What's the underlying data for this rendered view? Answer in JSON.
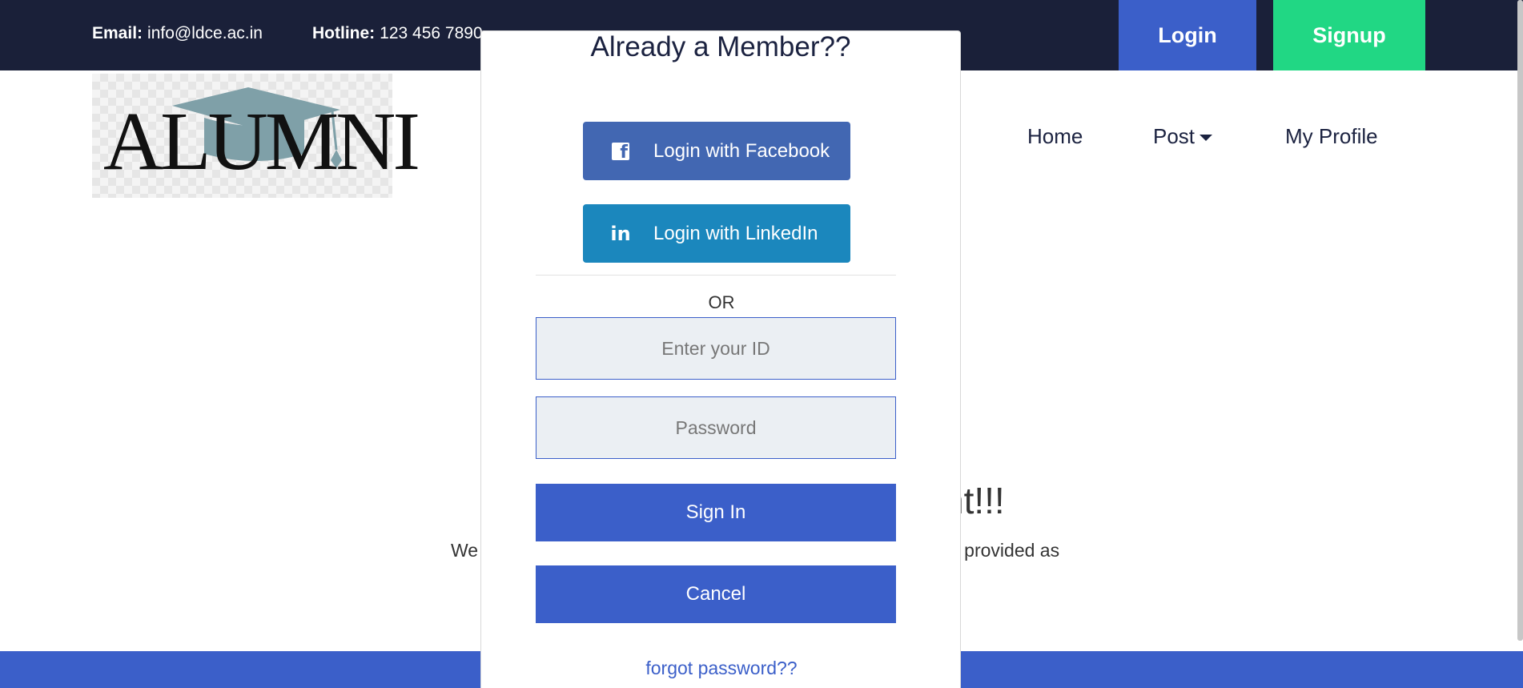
{
  "topbar": {
    "email_label": "Email:",
    "email_value": "info@ldce.ac.in",
    "hotline_label": "Hotline:",
    "hotline_value": "123 456 7890",
    "login_label": "Login",
    "signup_label": "Signup"
  },
  "logo": {
    "text": "ALUMNI"
  },
  "nav": {
    "home": "Home",
    "post": "Post",
    "profile": "My Profile"
  },
  "background": {
    "heading_fragment": "nt!!!",
    "text_left": "We",
    "text_right": "n provided as"
  },
  "modal": {
    "title": "Already a Member??",
    "facebook_label": "Login with Facebook",
    "linkedin_label": "Login with LinkedIn",
    "or_text": "OR",
    "id_placeholder": "Enter your ID",
    "password_placeholder": "Password",
    "signin_label": "Sign In",
    "cancel_label": "Cancel",
    "forgot_label": "forgot password??"
  },
  "colors": {
    "topbar_bg": "#1a2039",
    "primary": "#3b5fc9",
    "signup": "#21d784",
    "facebook": "#4267b2",
    "linkedin": "#1b87bd"
  },
  "icons": [
    "facebook-icon",
    "linkedin-icon",
    "caret-down-icon",
    "graduation-cap-icon"
  ]
}
